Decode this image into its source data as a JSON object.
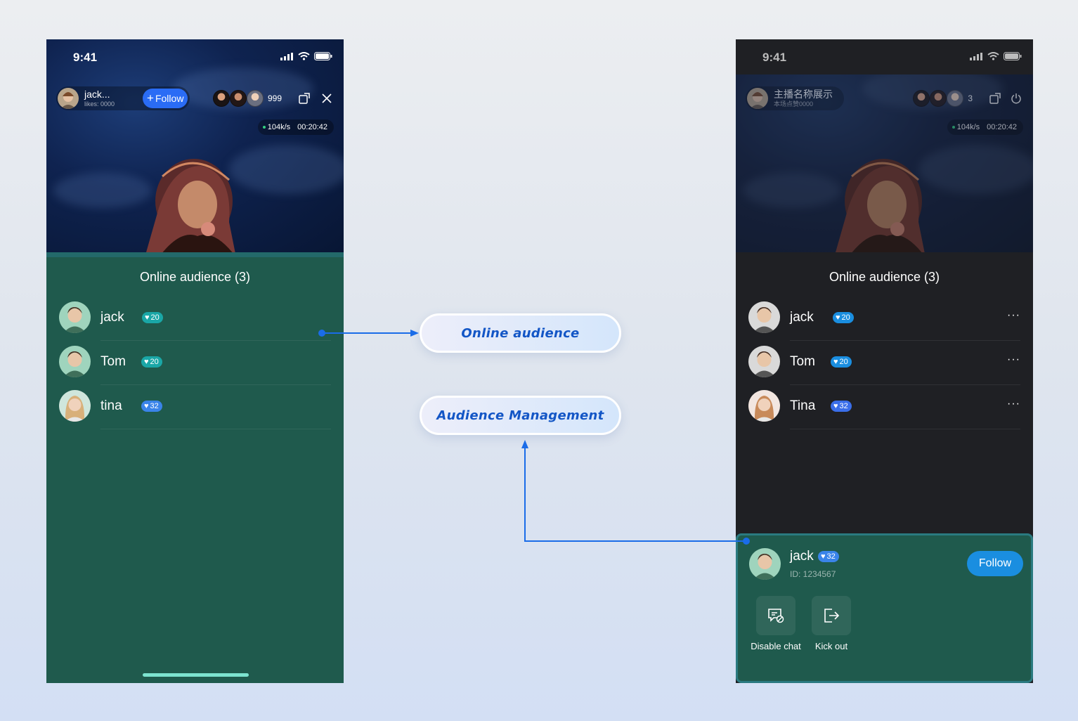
{
  "left_phone": {
    "status_time": "9:41",
    "host": {
      "name": "jack...",
      "likes": "likes: 0000"
    },
    "follow_label": "Follow",
    "viewer_count": "999",
    "speed": "104k/s",
    "duration": "00:20:42",
    "panel_title": "Online audience (3)",
    "audience": [
      {
        "name": "jack",
        "level": "20"
      },
      {
        "name": "Tom",
        "level": "20"
      },
      {
        "name": "tina",
        "level": "32"
      }
    ]
  },
  "right_phone": {
    "status_time": "9:41",
    "host": {
      "name": "主播名称展示",
      "likes": "本场点赞0000"
    },
    "viewer_count": "3",
    "speed": "104k/s",
    "duration": "00:20:42",
    "panel_title": "Online audience (3)",
    "more_label": "···",
    "audience": [
      {
        "name": "jack",
        "level": "20"
      },
      {
        "name": "Tom",
        "level": "20"
      },
      {
        "name": "Tina",
        "level": "32"
      }
    ],
    "manage": {
      "name": "jack",
      "level": "32",
      "id": "ID: 1234567",
      "follow_label": "Follow",
      "actions": [
        {
          "label": "Disable chat",
          "icon": "disable-chat-icon"
        },
        {
          "label": "Kick out",
          "icon": "kick-out-icon"
        }
      ]
    }
  },
  "callouts": {
    "online": "Online audience",
    "manage": "Audience Management"
  },
  "colors": {
    "left_panel": "#1f5a4d",
    "right_panel": "#1f2024",
    "accent_blue": "#1356c6",
    "follow_blue": "#2a6cf5",
    "badge_teal": "#1aa7a7",
    "badge_blue": "#3a84e9"
  }
}
